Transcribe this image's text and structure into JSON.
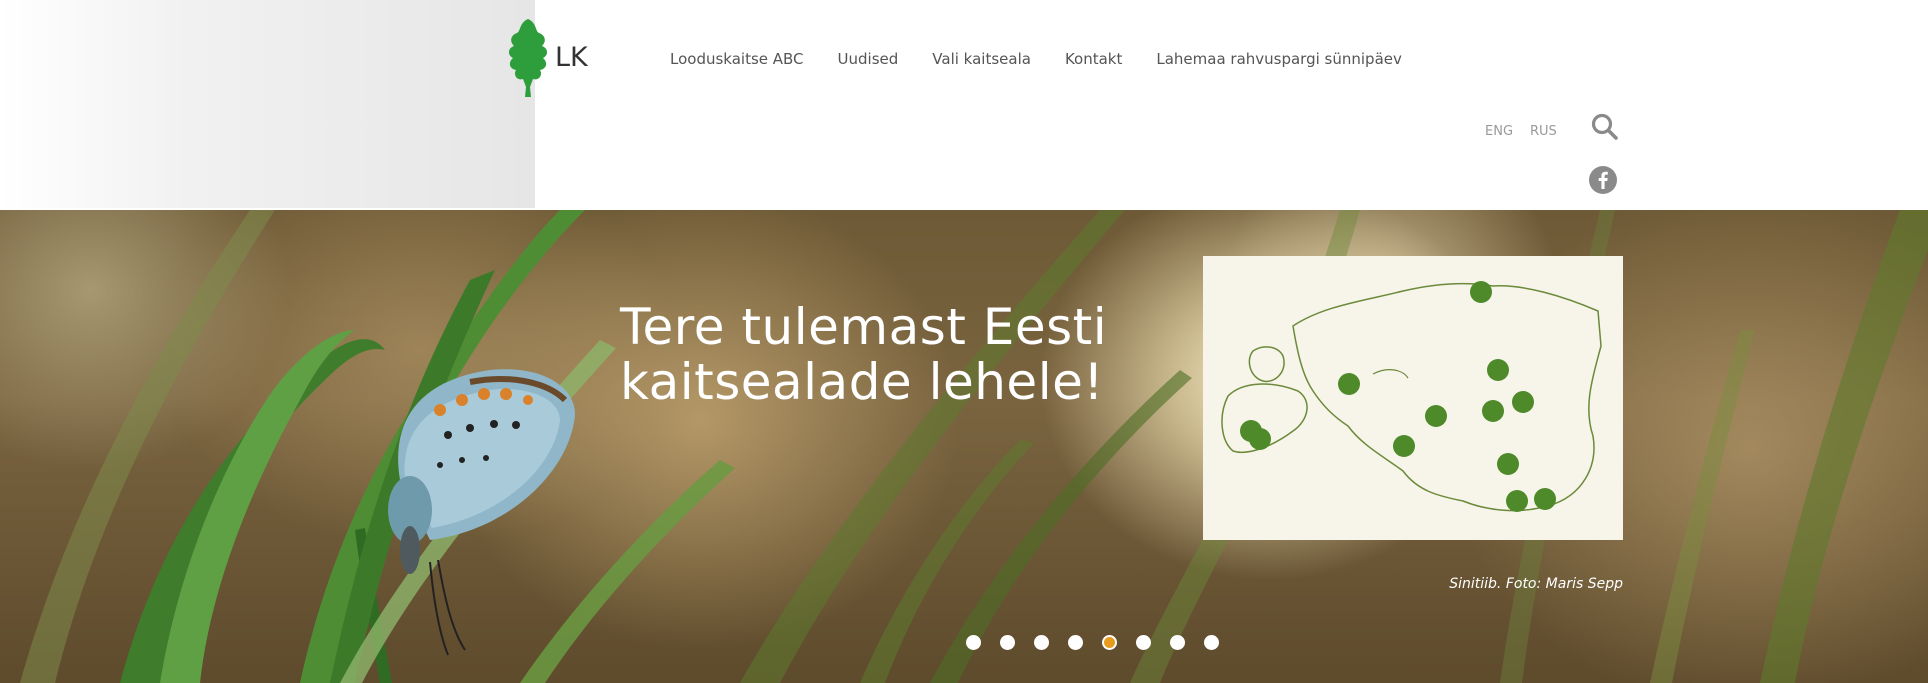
{
  "header": {
    "logo_text": "LK",
    "nav": [
      {
        "label": "Looduskaitse ABC"
      },
      {
        "label": "Uudised"
      },
      {
        "label": "Vali kaitseala"
      },
      {
        "label": "Kontakt"
      },
      {
        "label": "Lahemaa rahvuspargi sünnipäev"
      }
    ],
    "lang_eng": "ENG",
    "lang_rus": "RUS",
    "icons": [
      "oak-leaf-logo",
      "search-icon",
      "facebook-icon"
    ]
  },
  "hero": {
    "title": "Tere tulemast Eesti kaitsealade lehele!",
    "caption": "Sinitiib. Foto: Maris Sepp",
    "slides": {
      "count": 8,
      "active_index": 4
    },
    "colors": {
      "map_pin": "#4e8a2a",
      "active_dot": "#e89b1d",
      "map_bg": "#f7f4ea"
    }
  }
}
